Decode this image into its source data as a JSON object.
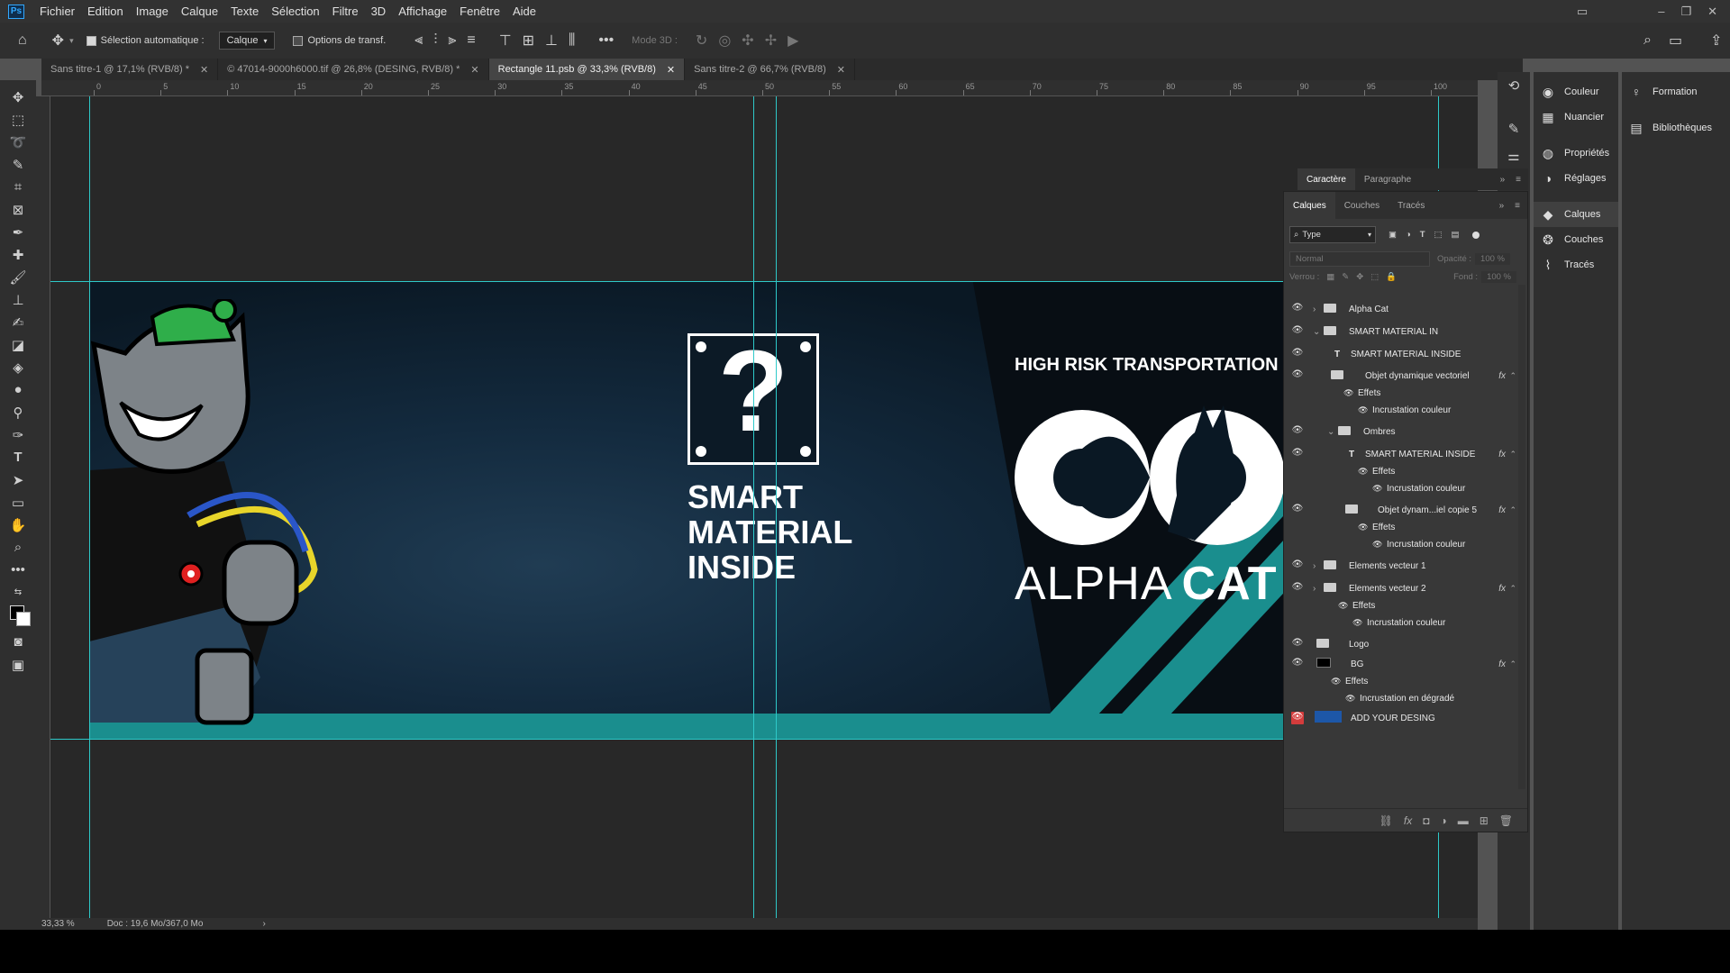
{
  "menu": {
    "app_icon": "Ps",
    "items": [
      "Fichier",
      "Edition",
      "Image",
      "Calque",
      "Texte",
      "Sélection",
      "Filtre",
      "3D",
      "Affichage",
      "Fenêtre",
      "Aide"
    ]
  },
  "window_controls": {
    "minimize": "–",
    "restore": "❐",
    "close": "✕"
  },
  "options_bar": {
    "auto_select_label": "Sélection automatique :",
    "auto_select_value": "Calque",
    "transform_label": "Options de transf.",
    "mode3d": "Mode 3D :"
  },
  "tabs": [
    {
      "label": "Sans titre-1 @ 17,1% (RVB/8) *"
    },
    {
      "label": "© 47014-9000h6000.tif @ 26,8% (DESING, RVB/8) *"
    },
    {
      "label": "Rectangle 11.psb @ 33,3% (RVB/8)"
    },
    {
      "label": "Sans titre-2 @ 66,7% (RVB/8)"
    }
  ],
  "ruler": {
    "ticks": [
      "0",
      "5",
      "10",
      "15",
      "20",
      "25",
      "30",
      "35",
      "40",
      "45",
      "50",
      "55",
      "60",
      "65",
      "70",
      "75",
      "80",
      "85",
      "90",
      "95",
      "100"
    ]
  },
  "artwork": {
    "smart_lines": [
      "SMART",
      "MATERIAL",
      "INSIDE"
    ],
    "question_mark": "?",
    "tagline": "HIGH RISK TRANSPORTATION",
    "brand_light": "ALPHA",
    "brand_bold": "CAT"
  },
  "colors": {
    "teal": "#1a8e8e",
    "guide": "#2ec9c9",
    "selected_eye": "#d43c3c"
  },
  "status": {
    "zoom": "33,33 %",
    "doc": "Doc : 19,6 Mo/367,0 Mo"
  },
  "panels_a": [
    {
      "label": "Couleur",
      "icon": "palette-icon"
    },
    {
      "label": "Nuancier",
      "icon": "swatches-icon"
    },
    {
      "label": "Propriétés",
      "icon": "properties-icon"
    },
    {
      "label": "Réglages",
      "icon": "adjustments-icon"
    },
    {
      "label": "Calques",
      "icon": "layers-icon"
    },
    {
      "label": "Couches",
      "icon": "channels-icon"
    },
    {
      "label": "Tracés",
      "icon": "paths-icon"
    }
  ],
  "panels_b": [
    {
      "label": "Formation",
      "icon": "lightbulb-icon"
    },
    {
      "label": "Bibliothèques",
      "icon": "libraries-icon"
    }
  ],
  "char_tabs": {
    "caractere": "Caractère",
    "paragraphe": "Paragraphe"
  },
  "layers_panel": {
    "tabs": [
      "Calques",
      "Couches",
      "Tracés"
    ],
    "filter": "Type",
    "blend_mode": "Normal",
    "opacity_label": "Opacité :",
    "opacity_value": "100 %",
    "lock_label": "Verrou :",
    "fill_label": "Fond :",
    "fill_value": "100 %",
    "rows": [
      {
        "name": "Alpha Cat"
      },
      {
        "name": "SMART MATERIAL IN"
      },
      {
        "name": "SMART MATERIAL INSIDE"
      },
      {
        "name": "Objet dynamique vectoriel",
        "fx": "fx"
      },
      {
        "name": "Effets"
      },
      {
        "name": "Incrustation couleur"
      },
      {
        "name": "Ombres"
      },
      {
        "name": "SMART MATERIAL INSIDE",
        "fx": "fx"
      },
      {
        "name": "Effets"
      },
      {
        "name": "Incrustation couleur"
      },
      {
        "name": "Objet dynam...iel copie 5",
        "fx": "fx"
      },
      {
        "name": "Effets"
      },
      {
        "name": "Incrustation couleur"
      },
      {
        "name": "Elements vecteur 1"
      },
      {
        "name": "Elements vecteur 2",
        "fx": "fx"
      },
      {
        "name": "Effets"
      },
      {
        "name": "Incrustation couleur"
      },
      {
        "name": "Logo"
      },
      {
        "name": "BG",
        "fx": "fx"
      },
      {
        "name": "Effets"
      },
      {
        "name": "Incrustation en dégradé"
      },
      {
        "name": "ADD YOUR DESING"
      }
    ]
  }
}
